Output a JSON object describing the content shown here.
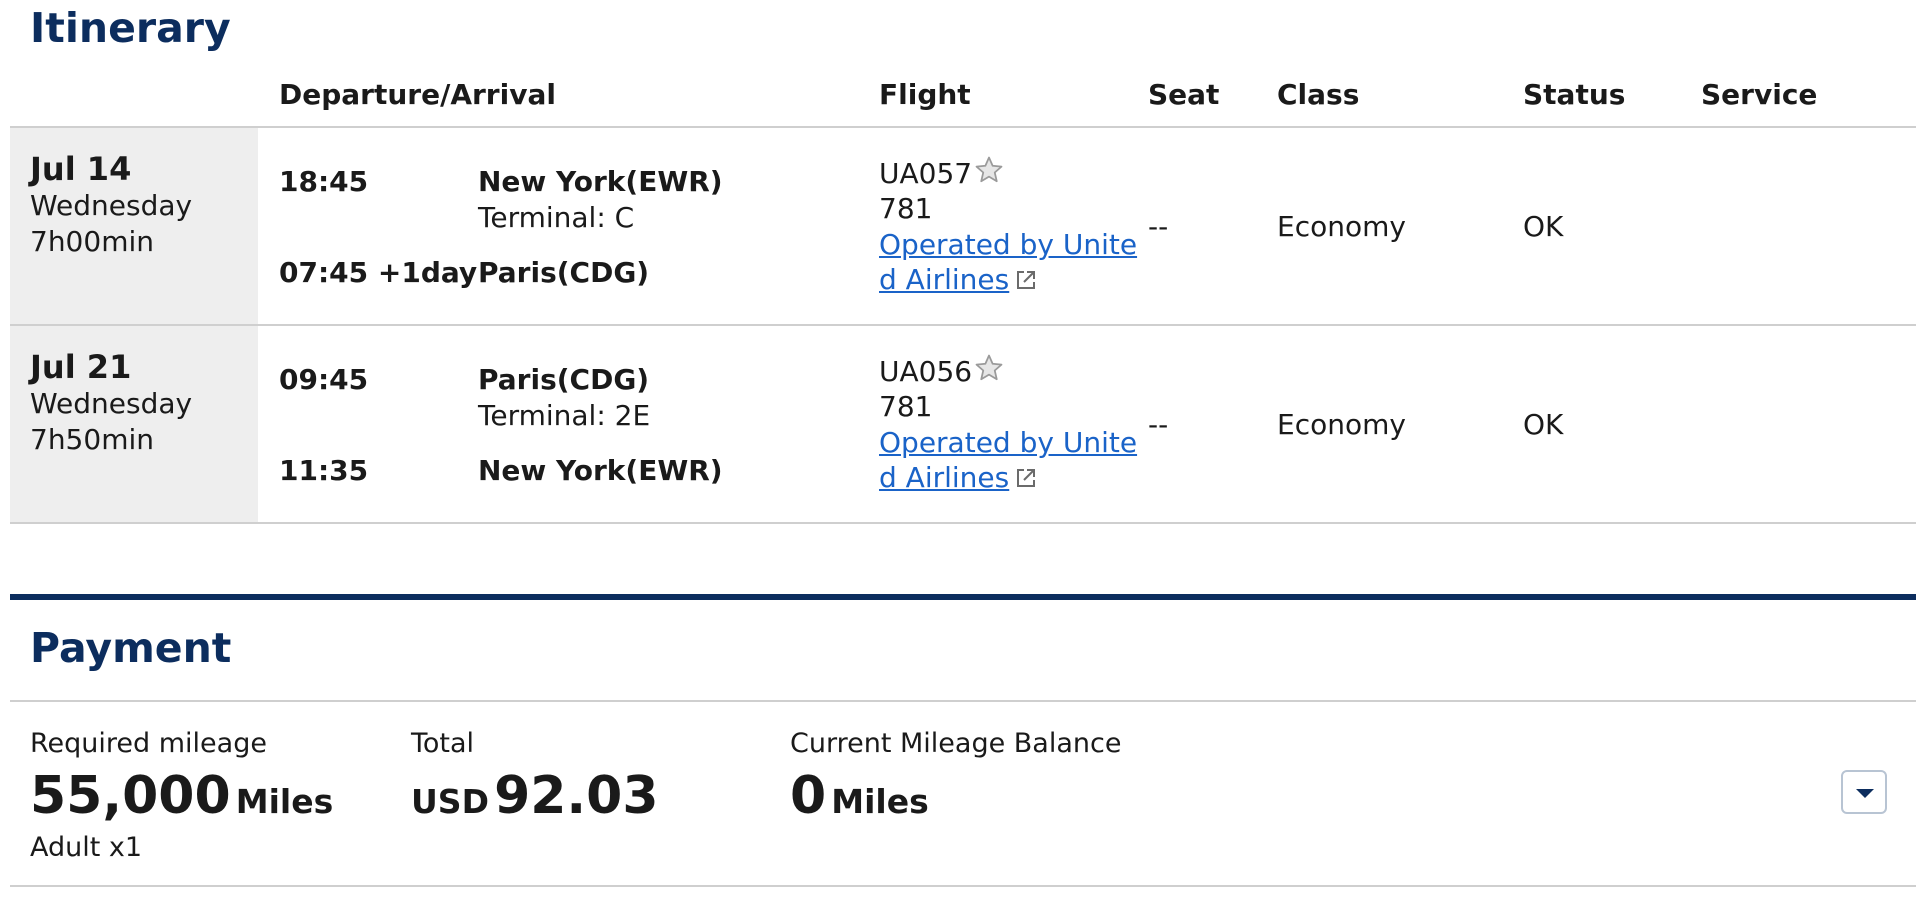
{
  "itinerary": {
    "title": "Itinerary",
    "columns": {
      "dep_arr": "Departure/Arrival",
      "flight": "Flight",
      "seat": "Seat",
      "class": "Class",
      "status": "Status",
      "service": "Service"
    },
    "rows": [
      {
        "date": "Jul 14",
        "weekday": "Wednesday",
        "duration": "7h00min",
        "dep_time": "18:45",
        "dep_city": "New York(EWR)",
        "dep_terminal": "Terminal: C",
        "arr_time": "07:45 +1day",
        "arr_city": "Paris(CDG)",
        "flight_no": "UA057",
        "aircraft": "781",
        "operated_line1": "Operated by Unite",
        "operated_line2": "d Airlines",
        "seat": "--",
        "class": "Economy",
        "status": "OK"
      },
      {
        "date": "Jul 21",
        "weekday": "Wednesday",
        "duration": "7h50min",
        "dep_time": "09:45",
        "dep_city": "Paris(CDG)",
        "dep_terminal": "Terminal: 2E",
        "arr_time": "11:35",
        "arr_city": "New York(EWR)",
        "flight_no": "UA056",
        "aircraft": "781",
        "operated_line1": "Operated by Unite",
        "operated_line2": "d Airlines",
        "seat": "--",
        "class": "Economy",
        "status": "OK"
      }
    ]
  },
  "payment": {
    "title": "Payment",
    "required_label": "Required mileage",
    "required_value": "55,000",
    "required_unit": "Miles",
    "passengers": "Adult x1",
    "total_label": "Total",
    "total_currency": "USD",
    "total_value": "92.03",
    "balance_label": "Current Mileage Balance",
    "balance_value": "0",
    "balance_unit": "Miles"
  },
  "icons": {
    "star": "star-award-icon",
    "external": "external-link-icon",
    "dropdown": "chevron-down-icon"
  },
  "colors": {
    "heading": "#0c2d5e",
    "link": "#1a63c8",
    "day_cell_bg": "#eeeeee"
  }
}
